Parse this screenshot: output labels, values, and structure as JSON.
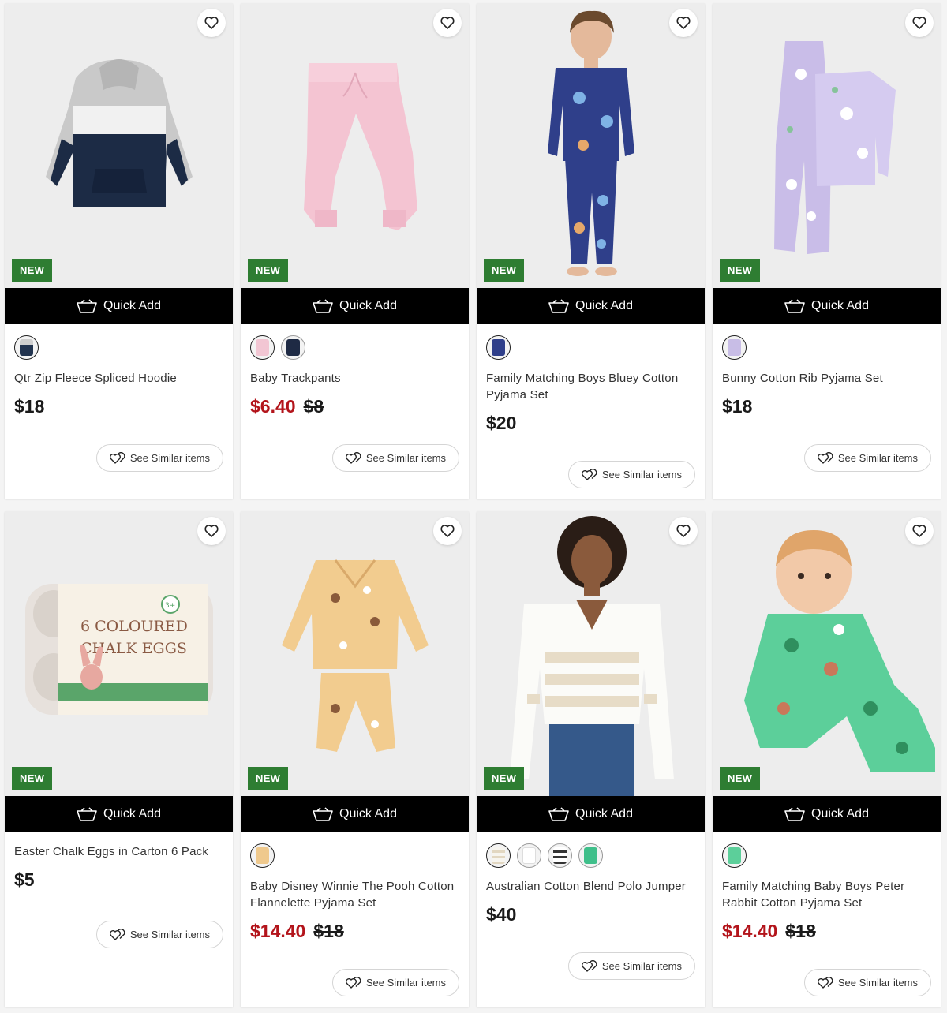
{
  "products": [
    {
      "title": "Qtr Zip Fleece Spliced Hoodie",
      "badge": "NEW",
      "quick_add": "Quick Add",
      "price": "$18",
      "sale_price": "",
      "was_price": "",
      "see_similar": "See Similar items",
      "swatches": [
        "navy-grey hoodie"
      ],
      "swatch_colors": [
        "#22344f"
      ]
    },
    {
      "title": "Baby Trackpants",
      "badge": "NEW",
      "quick_add": "Quick Add",
      "price": "",
      "sale_price": "$6.40",
      "was_price": "$8",
      "see_similar": "See Similar items",
      "swatches": [
        "pink trackpants",
        "navy trackpants"
      ],
      "swatch_colors": [
        "#f2c6d3",
        "#1e2a44"
      ]
    },
    {
      "title": "Family Matching Boys Bluey Cotton Pyjama Set",
      "badge": "NEW",
      "quick_add": "Quick Add",
      "price": "$20",
      "sale_price": "",
      "was_price": "",
      "see_similar": "See Similar items",
      "swatches": [
        "bluey pyjama"
      ],
      "swatch_colors": [
        "#2f3f8a"
      ]
    },
    {
      "title": "Bunny Cotton Rib Pyjama Set",
      "badge": "NEW",
      "quick_add": "Quick Add",
      "price": "$18",
      "sale_price": "",
      "was_price": "",
      "see_similar": "See Similar items",
      "swatches": [
        "lilac pyjama"
      ],
      "swatch_colors": [
        "#c8bde6"
      ]
    },
    {
      "title": "Easter Chalk Eggs in Carton 6 Pack",
      "badge": "NEW",
      "quick_add": "Quick Add",
      "price": "$5",
      "sale_price": "",
      "was_price": "",
      "see_similar": "See Similar items",
      "swatches": [],
      "swatch_colors": [],
      "image_text": [
        "6 COLOURED",
        "CHALK EGGS",
        "3+"
      ]
    },
    {
      "title": "Baby Disney Winnie The Pooh Cotton Flannelette Pyjama Set",
      "badge": "NEW",
      "quick_add": "Quick Add",
      "price": "",
      "sale_price": "$14.40",
      "was_price": "$18",
      "see_similar": "See Similar items",
      "swatches": [
        "yellow pyjama"
      ],
      "swatch_colors": [
        "#efc98d"
      ]
    },
    {
      "title": "Australian Cotton Blend Polo Jumper",
      "badge": "NEW",
      "quick_add": "Quick Add",
      "price": "$40",
      "sale_price": "",
      "was_price": "",
      "see_similar": "See Similar items",
      "swatches": [
        "white stripe",
        "white plain",
        "black white stripe",
        "green"
      ],
      "swatch_colors": [
        "#f2efe6",
        "#ffffff",
        "#333333",
        "#3fbf8a"
      ]
    },
    {
      "title": "Family Matching Baby Boys Peter Rabbit Cotton Pyjama Set",
      "badge": "NEW",
      "quick_add": "Quick Add",
      "price": "",
      "sale_price": "$14.40",
      "was_price": "$18",
      "see_similar": "See Similar items",
      "swatches": [
        "green pyjama"
      ],
      "swatch_colors": [
        "#5ccf9a"
      ]
    }
  ],
  "icons": {
    "wishlist": "heart-outline-icon",
    "quick_add": "basket-icon",
    "similar": "hearts-outline-icon"
  },
  "colors": {
    "badge": "#2e7d32",
    "sale": "#b3141b",
    "quick_add_bg": "#000000"
  }
}
